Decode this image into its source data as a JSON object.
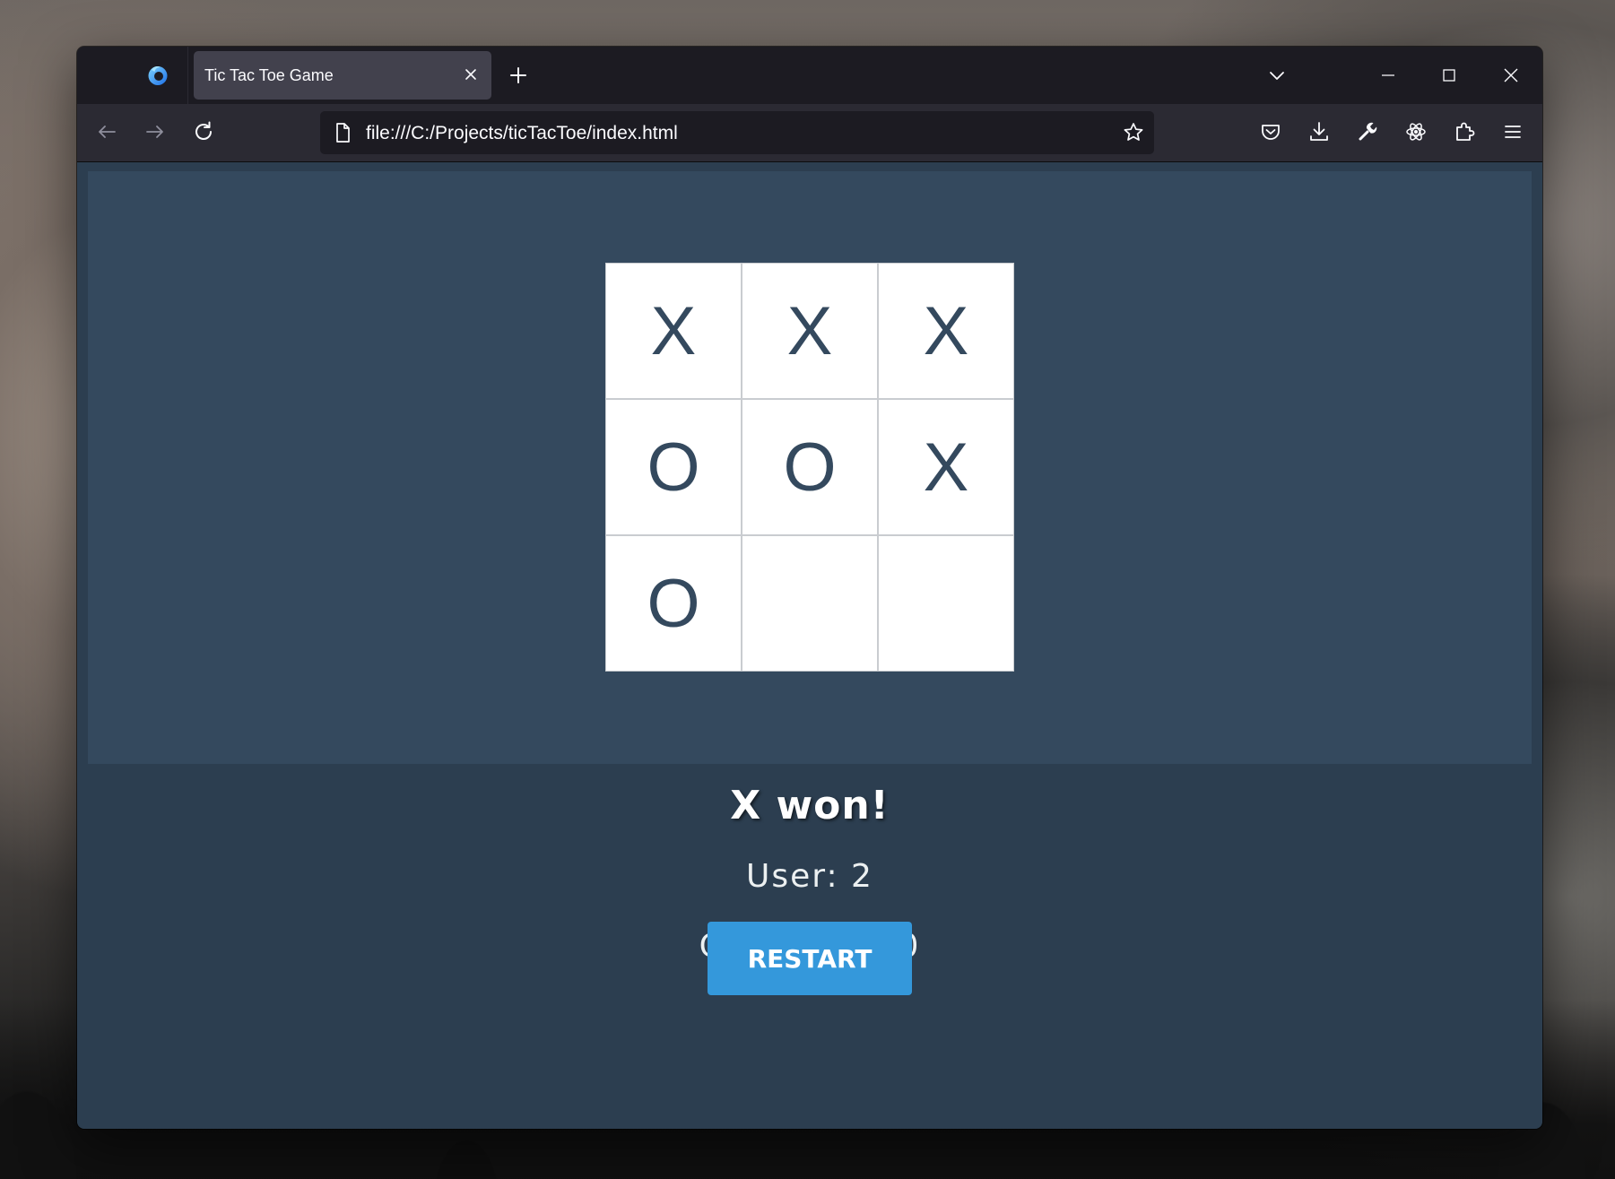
{
  "browser": {
    "tab_title": "Tic Tac Toe Game",
    "url": "file:///C:/Projects/ticTacToe/index.html"
  },
  "game": {
    "board": [
      [
        "X",
        "X",
        "X"
      ],
      [
        "O",
        "O",
        "X"
      ],
      [
        "O",
        "",
        ""
      ]
    ],
    "status": "X won!",
    "user_score_text": "User: 2",
    "computer_score_text": "Computer: 0",
    "restart_label": "RESTART"
  },
  "colors": {
    "page_background": "#2c3e50",
    "board_area_background": "#34495e",
    "mark_color": "#34495e",
    "restart_button": "#3498db"
  },
  "icons": {
    "browser_logo": "firefox-icon",
    "tab_close": "close-icon",
    "new_tab": "plus-icon",
    "tab_list": "chevron-down-icon",
    "window_controls": [
      "minimize-icon",
      "maximize-icon",
      "close-icon"
    ],
    "navigation": [
      "back-arrow-icon",
      "forward-arrow-icon",
      "reload-icon"
    ],
    "url_bar": [
      "page-icon",
      "star-icon"
    ],
    "toolbar": [
      "pocket-icon",
      "download-icon",
      "wrench-icon",
      "atom-icon",
      "puzzle-icon",
      "hamburger-menu-icon"
    ]
  }
}
